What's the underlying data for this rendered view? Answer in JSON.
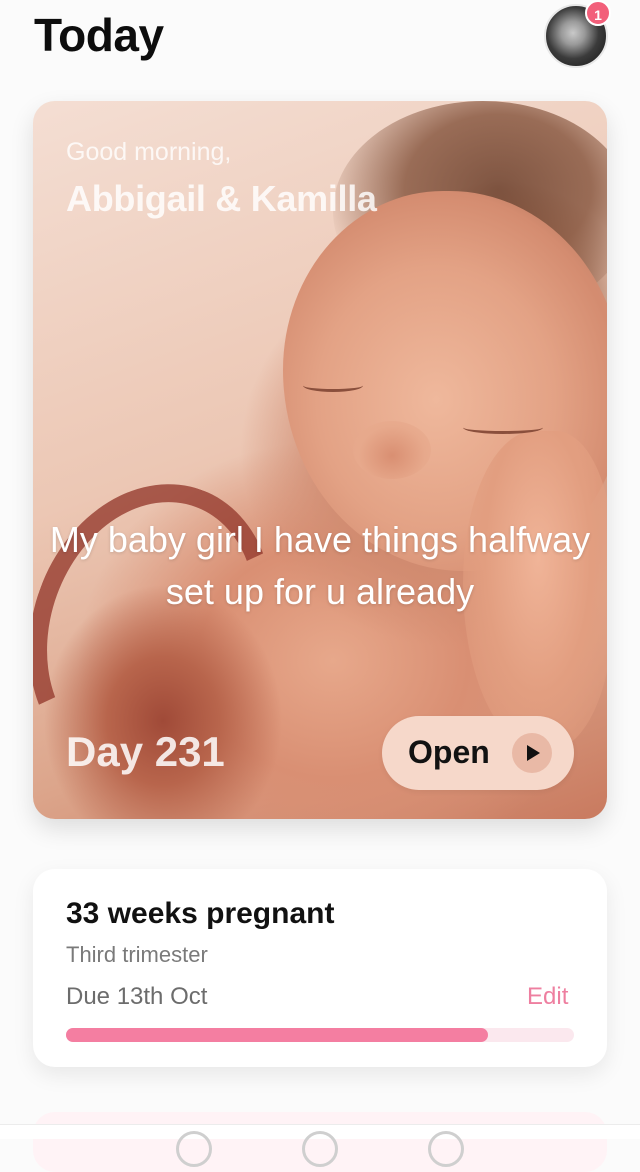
{
  "header": {
    "title": "Today",
    "notification_count": "1"
  },
  "hero": {
    "greeting": "Good morning,",
    "names": "Abbigail & Kamilla",
    "caption": "My baby girl I have things halfway set up for u already",
    "day": "Day 231",
    "open_label": "Open"
  },
  "pregnancy": {
    "weeks": "33 weeks pregnant",
    "trimester": "Third trimester",
    "due": "Due 13th Oct",
    "edit_label": "Edit",
    "progress_percent": 83
  },
  "colors": {
    "accent": "#f47ea1",
    "badge": "#f25f7a",
    "open_button": "#f6d8ca"
  }
}
